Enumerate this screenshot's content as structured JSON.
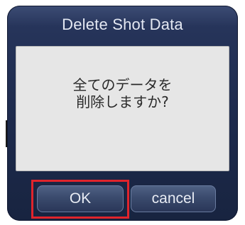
{
  "dialog": {
    "title": "Delete Shot Data",
    "message": "全てのデータを\n削除しますか?"
  },
  "buttons": {
    "ok_label": "OK",
    "cancel_label": "cancel"
  },
  "colors": {
    "dialog_background": "#1d2a4c",
    "message_background": "#e6e6e6",
    "highlight": "#e0242c"
  }
}
